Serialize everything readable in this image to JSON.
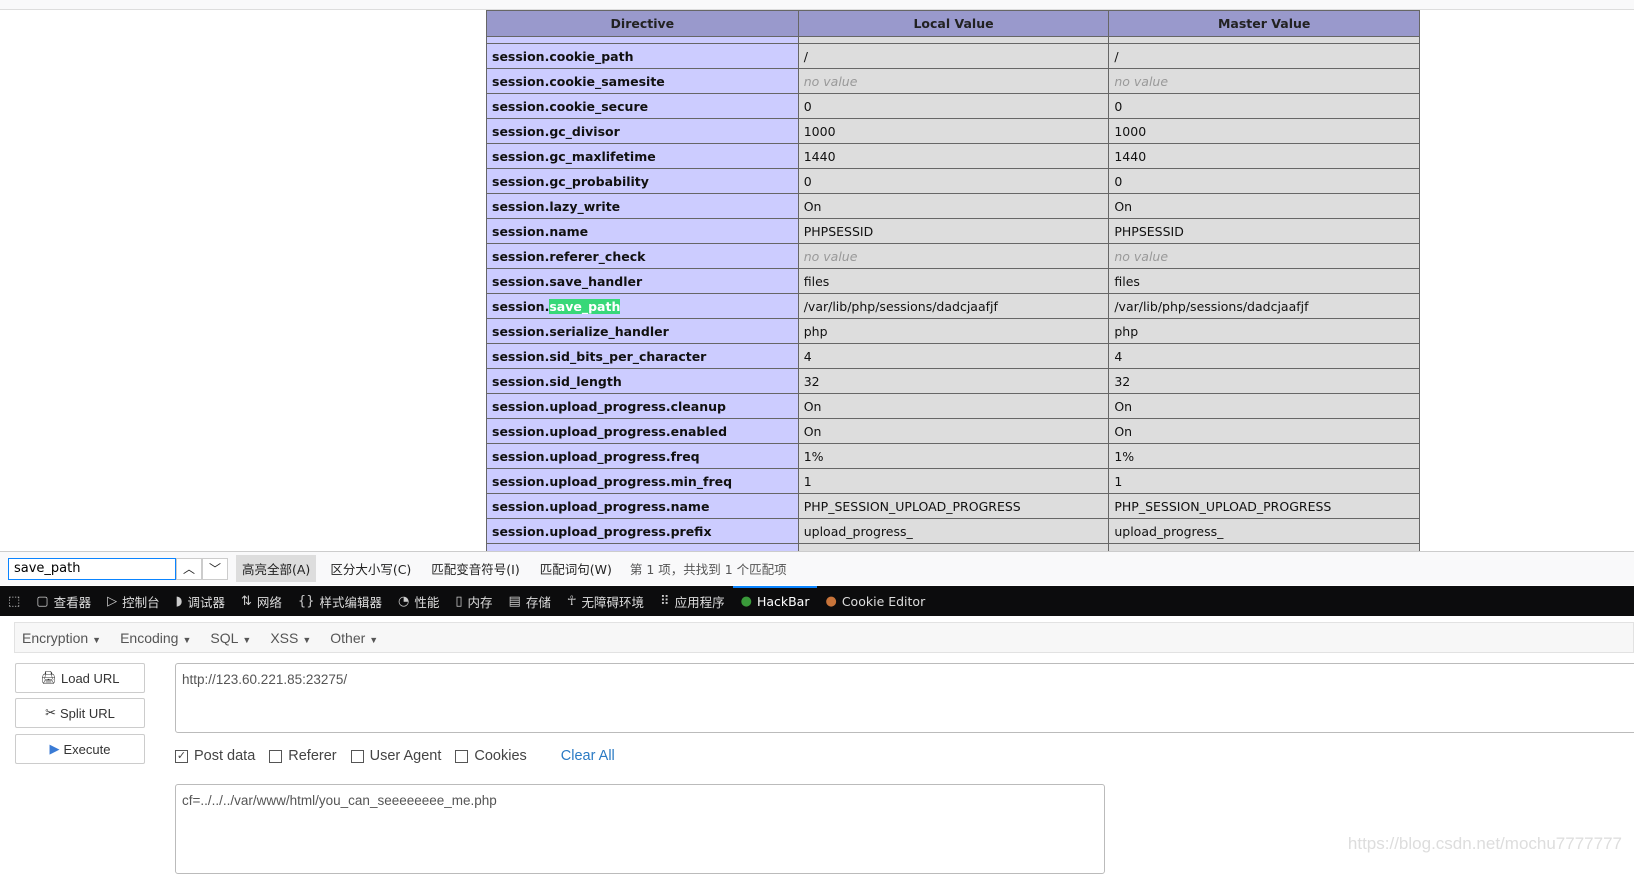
{
  "table": {
    "headers": [
      "Directive",
      "Local Value",
      "Master Value"
    ],
    "rows": [
      {
        "directive": "session.cookie_path",
        "local": "/",
        "master": "/"
      },
      {
        "directive": "session.cookie_samesite",
        "local": "no value",
        "master": "no value",
        "novalue": true
      },
      {
        "directive": "session.cookie_secure",
        "local": "0",
        "master": "0"
      },
      {
        "directive": "session.gc_divisor",
        "local": "1000",
        "master": "1000"
      },
      {
        "directive": "session.gc_maxlifetime",
        "local": "1440",
        "master": "1440"
      },
      {
        "directive": "session.gc_probability",
        "local": "0",
        "master": "0"
      },
      {
        "directive": "session.lazy_write",
        "local": "On",
        "master": "On"
      },
      {
        "directive": "session.name",
        "local": "PHPSESSID",
        "master": "PHPSESSID"
      },
      {
        "directive": "session.referer_check",
        "local": "no value",
        "master": "no value",
        "novalue": true
      },
      {
        "directive": "session.save_handler",
        "local": "files",
        "master": "files"
      },
      {
        "directive": "session.save_path",
        "local": "/var/lib/php/sessions/dadcjaafjf",
        "master": "/var/lib/php/sessions/dadcjaafjf",
        "highlight": "save_path"
      },
      {
        "directive": "session.serialize_handler",
        "local": "php",
        "master": "php"
      },
      {
        "directive": "session.sid_bits_per_character",
        "local": "4",
        "master": "4"
      },
      {
        "directive": "session.sid_length",
        "local": "32",
        "master": "32"
      },
      {
        "directive": "session.upload_progress.cleanup",
        "local": "On",
        "master": "On"
      },
      {
        "directive": "session.upload_progress.enabled",
        "local": "On",
        "master": "On"
      },
      {
        "directive": "session.upload_progress.freq",
        "local": "1%",
        "master": "1%"
      },
      {
        "directive": "session.upload_progress.min_freq",
        "local": "1",
        "master": "1"
      },
      {
        "directive": "session.upload_progress.name",
        "local": "PHP_SESSION_UPLOAD_PROGRESS",
        "master": "PHP_SESSION_UPLOAD_PROGRESS"
      },
      {
        "directive": "session.upload_progress.prefix",
        "local": "upload_progress_",
        "master": "upload_progress_"
      }
    ]
  },
  "findbar": {
    "query": "save_path",
    "highlight_all": "高亮全部(A)",
    "match_case": "区分大小写(C)",
    "match_diacritics": "匹配变音符号(I)",
    "whole_words": "匹配词句(W)",
    "status": "第 1 项，共找到 1 个匹配项"
  },
  "devtools": {
    "tabs": [
      {
        "label": "查看器",
        "icon": "inspector-icon"
      },
      {
        "label": "控制台",
        "icon": "console-icon"
      },
      {
        "label": "调试器",
        "icon": "debugger-icon"
      },
      {
        "label": "网络",
        "icon": "network-icon"
      },
      {
        "label": "样式编辑器",
        "icon": "style-editor-icon"
      },
      {
        "label": "性能",
        "icon": "performance-icon"
      },
      {
        "label": "内存",
        "icon": "memory-icon"
      },
      {
        "label": "存储",
        "icon": "storage-icon"
      },
      {
        "label": "无障碍环境",
        "icon": "accessibility-icon"
      },
      {
        "label": "应用程序",
        "icon": "application-icon"
      },
      {
        "label": "HackBar",
        "icon": "hackbar-icon",
        "active": true
      },
      {
        "label": "Cookie Editor",
        "icon": "cookie-icon"
      }
    ],
    "accent": "#0a84ff"
  },
  "hackbar": {
    "menu": [
      "Encryption",
      "Encoding",
      "SQL",
      "XSS",
      "Other"
    ],
    "load_url": "Load URL",
    "split_url": "Split URL",
    "execute": "Execute",
    "url": "http://123.60.221.85:23275/",
    "options": [
      {
        "label": "Post data",
        "checked": true
      },
      {
        "label": "Referer",
        "checked": false
      },
      {
        "label": "User Agent",
        "checked": false
      },
      {
        "label": "Cookies",
        "checked": false
      }
    ],
    "clear_all": "Clear All",
    "post_body": "cf=../../../var/www/html/you_can_seeeeeeee_me.php"
  },
  "watermark": "https://blog.csdn.net/mochu7777777"
}
